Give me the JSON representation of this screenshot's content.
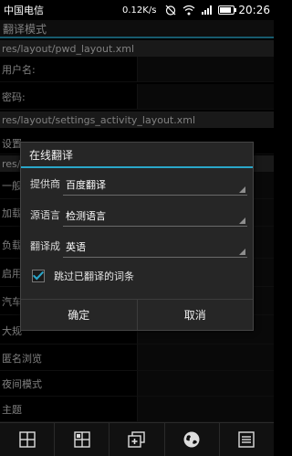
{
  "status_bar": {
    "carrier": "中国电信",
    "speed": "0.12K/s",
    "time": "20:26",
    "icons": [
      "alarm-off-icon",
      "wifi-icon",
      "signal-icon",
      "battery-icon"
    ]
  },
  "screen": {
    "title": "翻译模式",
    "paths": [
      "res/layout/pwd_layout.xml",
      "res/layout/settings_activity_layout.xml",
      "res/"
    ],
    "fields": [
      "用户名:",
      "密码:",
      "设置",
      "一般",
      "加载",
      "负载",
      "启用",
      "汽车",
      "大规",
      "匿名浏览",
      "夜间模式",
      "主题"
    ]
  },
  "dialog": {
    "title": "在线翻译",
    "rows": [
      {
        "label": "提供商",
        "value": "百度翻译"
      },
      {
        "label": "源语言",
        "value": "检测语言"
      },
      {
        "label": "翻译成",
        "value": "英语"
      }
    ],
    "checkbox_label": "跳过已翻译的词条",
    "checkbox_checked": true,
    "ok_label": "确定",
    "cancel_label": "取消"
  },
  "toolbar": {
    "icons": [
      "grid-icon",
      "grid-alt-icon",
      "add-window-icon",
      "globe-icon",
      "list-icon"
    ]
  },
  "colors": {
    "accent": "#2aa6c9",
    "background": "#000000",
    "dialog_bg": "#262626"
  }
}
